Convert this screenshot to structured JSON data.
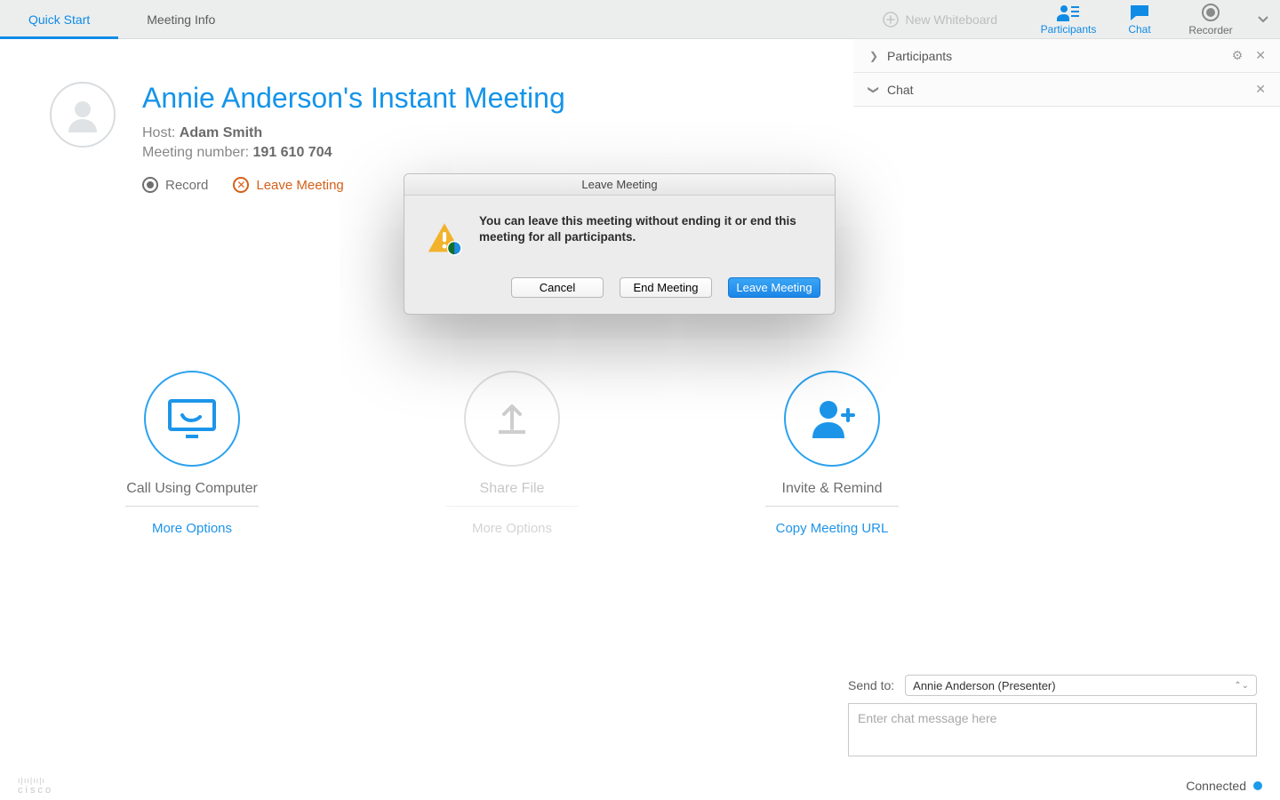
{
  "tabs": {
    "quick_start": "Quick Start",
    "meeting_info": "Meeting Info"
  },
  "new_whiteboard": "New Whiteboard",
  "panels": {
    "participants": "Participants",
    "chat": "Chat",
    "recorder": "Recorder"
  },
  "side": {
    "participants": "Participants",
    "chat": "Chat"
  },
  "meeting": {
    "title": "Annie Anderson's Instant Meeting",
    "host_label": "Host:",
    "host_name": "Adam Smith",
    "num_label": "Meeting number:",
    "number": "191 610 704",
    "record": "Record",
    "leave": "Leave Meeting"
  },
  "actions": {
    "call": "Call Using Computer",
    "share": "Share  File",
    "invite": "Invite & Remind",
    "more": "More Options",
    "more2": "More Options",
    "copy": "Copy Meeting URL"
  },
  "modal": {
    "title": "Leave Meeting",
    "text": "You can leave this meeting without ending it or end this meeting for all participants.",
    "cancel": "Cancel",
    "end": "End Meeting",
    "leave": "Leave Meeting"
  },
  "chat": {
    "send_to": "Send to:",
    "recipient": "Annie Anderson (Presenter)",
    "placeholder": "Enter chat message here"
  },
  "footer": {
    "brand": "cisco",
    "connected": "Connected"
  }
}
